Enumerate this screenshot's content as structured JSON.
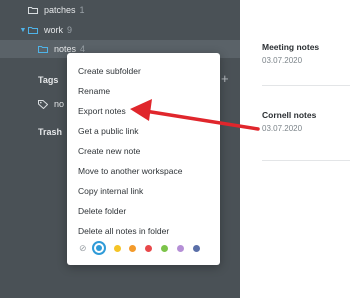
{
  "sidebar": {
    "folders": [
      {
        "name": "patches",
        "count": "1"
      },
      {
        "name": "work",
        "count": "9"
      },
      {
        "name": "notes",
        "count": "4"
      }
    ],
    "tags_label": "Tags",
    "tag_partial": "no",
    "trash_label": "Trash"
  },
  "notes": [
    {
      "title": "Meeting notes",
      "date": "03.07.2020"
    },
    {
      "title": "Cornell notes",
      "date": "03.07.2020"
    }
  ],
  "context_menu": {
    "items": [
      "Create subfolder",
      "Rename",
      "Export notes",
      "Get a public link",
      "Create new note",
      "Move to another workspace",
      "Copy internal link",
      "Delete folder",
      "Delete all notes in folder"
    ],
    "colors": [
      "#2f9bd8",
      "#f5c426",
      "#f39a2b",
      "#e8484a",
      "#7cc44a",
      "#b58fd6",
      "#5a6fa8"
    ],
    "selected_color": "#2f9bd8"
  },
  "annotation": {
    "arrow_color": "#e0262c"
  }
}
